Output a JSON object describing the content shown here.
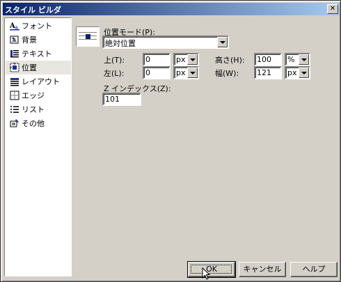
{
  "window": {
    "title": "スタイル ビルダ",
    "close_glyph": "✕"
  },
  "sidebar": {
    "items": [
      {
        "label": "フォント",
        "icon": "font-icon"
      },
      {
        "label": "背景",
        "icon": "background-icon"
      },
      {
        "label": "テキスト",
        "icon": "text-icon"
      },
      {
        "label": "位置",
        "icon": "position-icon",
        "selected": true
      },
      {
        "label": "レイアウト",
        "icon": "layout-icon"
      },
      {
        "label": "エッジ",
        "icon": "edges-icon"
      },
      {
        "label": "リスト",
        "icon": "list-icon"
      },
      {
        "label": "その他",
        "icon": "other-icon"
      }
    ]
  },
  "position": {
    "mode_label": "位置モード(P):",
    "mode_value": "絶対位置",
    "top_label": "上(T):",
    "top_value": "0",
    "top_unit": "px",
    "left_label": "左(L):",
    "left_value": "0",
    "left_unit": "px",
    "height_label": "高さ(H):",
    "height_value": "100",
    "height_unit": "%",
    "width_label": "幅(W):",
    "width_value": "121",
    "width_unit": "px",
    "zindex_label": "Z インデックス(Z):",
    "zindex_value": "101"
  },
  "buttons": {
    "ok": "OK",
    "cancel": "キャンセル",
    "help": "ヘルプ"
  }
}
